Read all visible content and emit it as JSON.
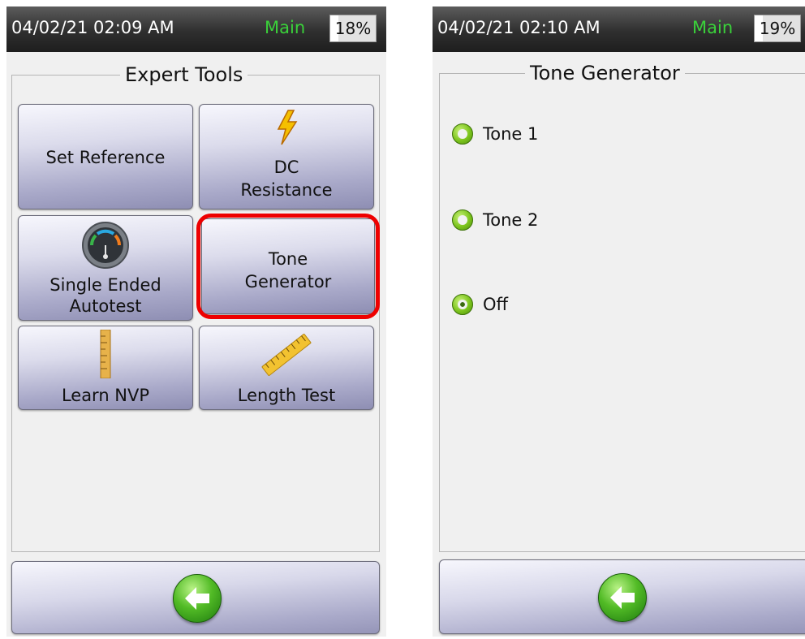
{
  "left_screen": {
    "status": {
      "time": "04/02/21 02:09 AM",
      "mode": "Main",
      "battery": "18%"
    },
    "title": "Expert Tools",
    "buttons": [
      {
        "label": "Set Reference",
        "icon": "none"
      },
      {
        "label_line1": "DC",
        "label_line2": "Resistance",
        "icon": "lightning-icon"
      },
      {
        "label_line1": "Single Ended",
        "label_line2": "Autotest",
        "icon": "gauge-icon"
      },
      {
        "label_line1": "Tone",
        "label_line2": "Generator",
        "icon": "none",
        "highlighted": true
      },
      {
        "label": "Learn NVP",
        "icon": "ruler-icon"
      },
      {
        "label": "Length Test",
        "icon": "tape-measure-icon"
      }
    ],
    "back_icon": "back-arrow-icon"
  },
  "right_screen": {
    "status": {
      "time": "04/02/21 02:10 AM",
      "mode": "Main",
      "battery": "19%"
    },
    "title": "Tone Generator",
    "options": [
      {
        "label": "Tone 1",
        "selected": false
      },
      {
        "label": "Tone 2",
        "selected": false
      },
      {
        "label": "Off",
        "selected": true
      }
    ],
    "back_icon": "back-arrow-icon"
  },
  "colors": {
    "highlight": "#ee0000",
    "status_mode": "#3ad13a",
    "accent_green": "#52bb26"
  }
}
